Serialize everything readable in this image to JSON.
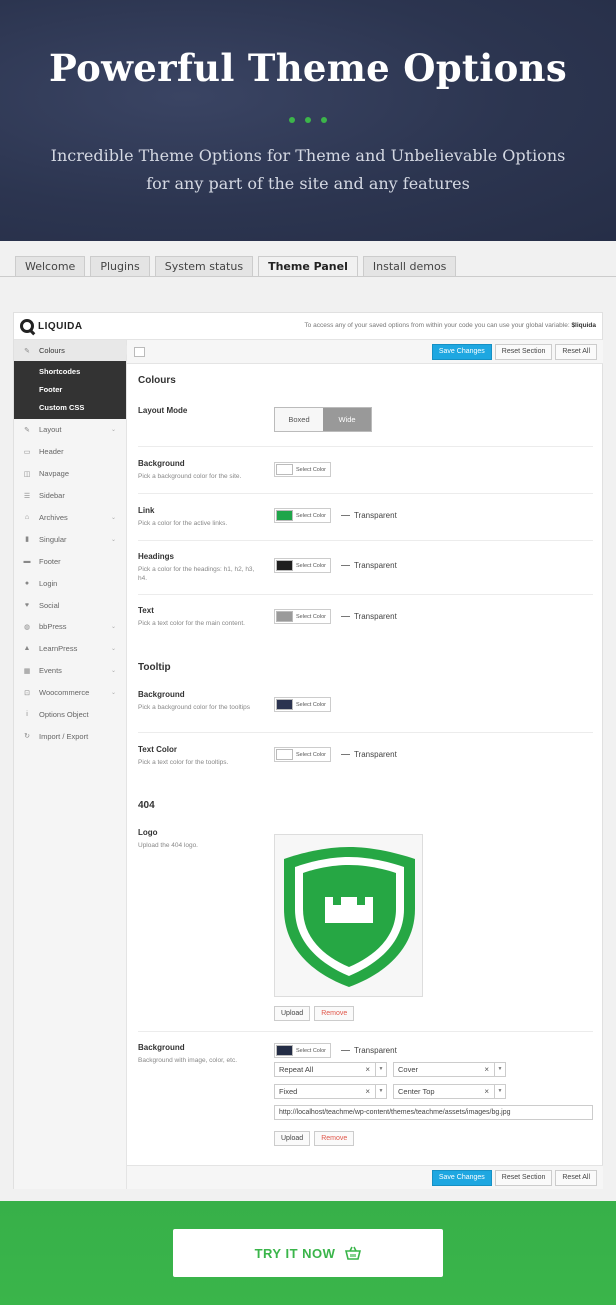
{
  "hero": {
    "title": "Powerful Theme Options",
    "subtitle_line1": "Incredible Theme Options for Theme and Unbelievable Options",
    "subtitle_line2": "for any part of the site and any features"
  },
  "tabs": [
    "Welcome",
    "Plugins",
    "System status",
    "Theme Panel",
    "Install demos"
  ],
  "panel": {
    "logo": "LIQUIDA",
    "note": "To access any of your saved options from within your code you can use your global variable:",
    "note_var": "$liquida",
    "sidebar": {
      "active": "Colours",
      "subitems": [
        "Shortcodes",
        "Footer",
        "Custom CSS"
      ],
      "items": [
        {
          "label": "Layout",
          "icon": "wrench-icon",
          "glyph": "✎",
          "caret": true
        },
        {
          "label": "Header",
          "icon": "header-icon",
          "glyph": "▭",
          "caret": false
        },
        {
          "label": "Navpage",
          "icon": "navpage-icon",
          "glyph": "◫",
          "caret": false
        },
        {
          "label": "Sidebar",
          "icon": "sidebar-icon",
          "glyph": "☰",
          "caret": false
        },
        {
          "label": "Archives",
          "icon": "home-icon",
          "glyph": "⌂",
          "caret": true
        },
        {
          "label": "Singular",
          "icon": "file-icon",
          "glyph": "▮",
          "caret": true
        },
        {
          "label": "Footer",
          "icon": "folder-icon",
          "glyph": "▬",
          "caret": false
        },
        {
          "label": "Login",
          "icon": "user-icon",
          "glyph": "●",
          "caret": false
        },
        {
          "label": "Social",
          "icon": "heart-icon",
          "glyph": "♥",
          "caret": false
        },
        {
          "label": "bbPress",
          "icon": "chat-icon",
          "glyph": "◍",
          "caret": true
        },
        {
          "label": "LearnPress",
          "icon": "graduation-icon",
          "glyph": "▲",
          "caret": true
        },
        {
          "label": "Events",
          "icon": "calendar-icon",
          "glyph": "▦",
          "caret": true
        },
        {
          "label": "Woocommerce",
          "icon": "cart-icon",
          "glyph": "⊡",
          "caret": true
        },
        {
          "label": "Options Object",
          "icon": "info-icon",
          "glyph": "i",
          "caret": false
        },
        {
          "label": "Import / Export",
          "icon": "refresh-icon",
          "glyph": "↻",
          "caret": false
        }
      ]
    },
    "buttons": {
      "save": "Save Changes",
      "reset_section": "Reset Section",
      "reset_all": "Reset All"
    },
    "sections": {
      "colours": "Colours",
      "tooltip": "Tooltip",
      "404": "404"
    },
    "layout_mode": {
      "label": "Layout Mode",
      "options": [
        "Boxed",
        "Wide"
      ],
      "selected": "Wide"
    },
    "select_color": "Select Color",
    "transparent": "Transparent",
    "rows": {
      "background": {
        "label": "Background",
        "desc": "Pick a background color for the site.",
        "color": "#ffffff"
      },
      "link": {
        "label": "Link",
        "desc": "Pick a color for the active links.",
        "color": "#1fa54a"
      },
      "headings": {
        "label": "Headings",
        "desc": "Pick a color for the headings: h1, h2, h3, h4.",
        "color": "#1f1f1f"
      },
      "text": {
        "label": "Text",
        "desc": "Pick a text color for the main content.",
        "color": "#9a9a9a"
      },
      "tt_background": {
        "label": "Background",
        "desc": "Pick a background color for the tooltips",
        "color": "#2b3350"
      },
      "tt_text": {
        "label": "Text Color",
        "desc": "Pick a text color for the tooltips.",
        "color": "#ffffff"
      },
      "logo": {
        "label": "Logo",
        "desc": "Upload the 404 logo."
      },
      "bg404": {
        "label": "Background",
        "desc": "Background with image, color, etc.",
        "color": "#232c45"
      }
    },
    "upload": "Upload",
    "remove": "Remove",
    "selects": {
      "repeat": "Repeat All",
      "size": "Cover",
      "attachment": "Fixed",
      "position": "Center Top"
    },
    "url": "http://localhost/teachme/wp-content/themes/teachme/assets/images/bg.jpg"
  },
  "cta": {
    "label": "TRY IT NOW",
    "icon": "basket-icon"
  }
}
